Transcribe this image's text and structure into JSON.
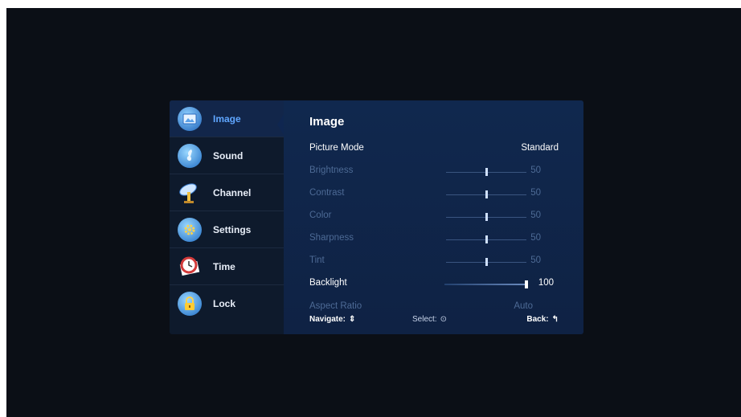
{
  "sidebar": {
    "items": [
      {
        "label": "Image",
        "icon": "image-icon",
        "active": true
      },
      {
        "label": "Sound",
        "icon": "music-note-icon"
      },
      {
        "label": "Channel",
        "icon": "satellite-dish-icon"
      },
      {
        "label": "Settings",
        "icon": "gear-icon"
      },
      {
        "label": "Time",
        "icon": "clock-icon"
      },
      {
        "label": "Lock",
        "icon": "padlock-icon"
      }
    ]
  },
  "panel": {
    "title": "Image",
    "picture_mode": {
      "label": "Picture Mode",
      "value": "Standard"
    },
    "sliders": [
      {
        "label": "Brightness",
        "value": "50",
        "level": 0.5
      },
      {
        "label": "Contrast",
        "value": "50",
        "level": 0.5
      },
      {
        "label": "Color",
        "value": "50",
        "level": 0.5
      },
      {
        "label": "Sharpness",
        "value": "50",
        "level": 0.5
      },
      {
        "label": "Tint",
        "value": "50",
        "level": 0.5
      },
      {
        "label": "Backlight",
        "value": "100",
        "level": 1.0
      }
    ],
    "aspect_ratio": {
      "label": "Aspect Ratio",
      "value": "Auto"
    }
  },
  "footer": {
    "navigate": "Navigate:",
    "navigate_glyph": "⇕",
    "select": "Select:",
    "select_glyph": "⊙",
    "back": "Back:",
    "back_glyph": "↰"
  },
  "colors": {
    "accent": "#5fa6ff",
    "panel": "#10284e",
    "sidebar": "#0e1a2c"
  }
}
